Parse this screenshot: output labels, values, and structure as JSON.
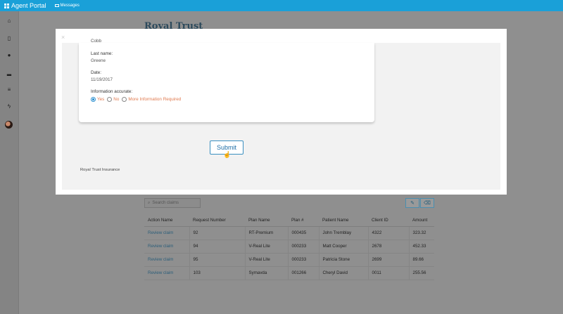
{
  "app": {
    "title": "Agent Portal",
    "messages_label": "Messages",
    "accent_color": "#1aa0d8"
  },
  "sidebar": {
    "icons": [
      "home-icon",
      "document-icon",
      "globe-icon",
      "chart-icon",
      "list-icon",
      "bolt-icon",
      "avatar"
    ]
  },
  "background": {
    "logo_text": "Royal Trust",
    "search_placeholder": "Search claims",
    "table": {
      "headers": [
        "Action Name",
        "Request Number",
        "Plan Name",
        "Plan #",
        "Patient Name",
        "Client ID",
        "Amount"
      ],
      "rows": [
        [
          "Review claim",
          "92",
          "RT-Premium",
          "000435",
          "John Tremblay",
          "4322",
          "323.32"
        ],
        [
          "Review claim",
          "94",
          "V-Real Lite",
          "000233",
          "Matt Cooper",
          "2678",
          "452.33"
        ],
        [
          "Review claim",
          "95",
          "V-Real Lite",
          "000233",
          "Patricia Stone",
          "2699",
          "89.66"
        ],
        [
          "Review claim",
          "103",
          "Symavda",
          "001266",
          "Cheryl David",
          "0011",
          "255.56"
        ]
      ]
    }
  },
  "modal": {
    "close_symbol": "×",
    "cut_value": "Cobb",
    "last_name_label": "Last name:",
    "last_name_value": "Greene",
    "date_label": "Date:",
    "date_value": "11/19/2017",
    "accuracy_label": "Information accurate:",
    "options": [
      "Yes",
      "No",
      "More Information Required"
    ],
    "selected_option": "Yes",
    "submit_label": "Submit",
    "footer_text": "Royal Trust Insurance"
  }
}
